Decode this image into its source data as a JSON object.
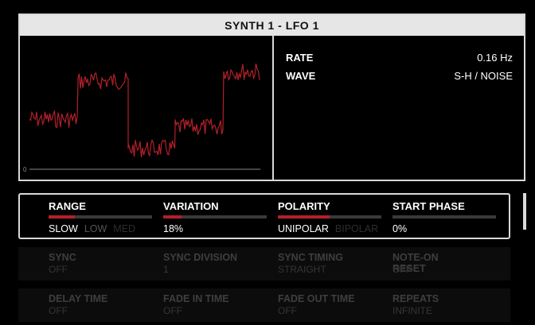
{
  "header": {
    "title": "SYNTH 1 - LFO 1"
  },
  "graph": {
    "zero_label": "0"
  },
  "info": [
    {
      "label": "RATE",
      "value": "0.16 Hz"
    },
    {
      "label": "WAVE",
      "value": "S-H / NOISE"
    }
  ],
  "params": {
    "range": {
      "label": "RANGE",
      "options": [
        "SLOW",
        "LOW",
        "MED"
      ],
      "fill": 0.25
    },
    "variation": {
      "label": "VARIATION",
      "value": "18%",
      "fill": 0.18
    },
    "polarity": {
      "label": "POLARITY",
      "options": [
        "UNIPOLAR",
        "BIPOLAR"
      ],
      "fill": 0.5
    },
    "start_phase": {
      "label": "START PHASE",
      "value": "0%",
      "fill": 0
    }
  },
  "row1": [
    {
      "label": "SYNC",
      "value": "OFF"
    },
    {
      "label": "SYNC DIVISION",
      "value": "1"
    },
    {
      "label": "SYNC TIMING",
      "value": "STRAIGHT"
    },
    {
      "label": "NOTE-ON RESET",
      "value": "OFF"
    }
  ],
  "row2": [
    {
      "label": "DELAY TIME",
      "value": "OFF"
    },
    {
      "label": "FADE IN TIME",
      "value": "OFF"
    },
    {
      "label": "FADE OUT TIME",
      "value": "OFF"
    },
    {
      "label": "REPEATS",
      "value": "INFINITE"
    }
  ],
  "colors": {
    "accent": "#b3202a",
    "panel_border": "#d9d9d9",
    "background": "#000000"
  }
}
